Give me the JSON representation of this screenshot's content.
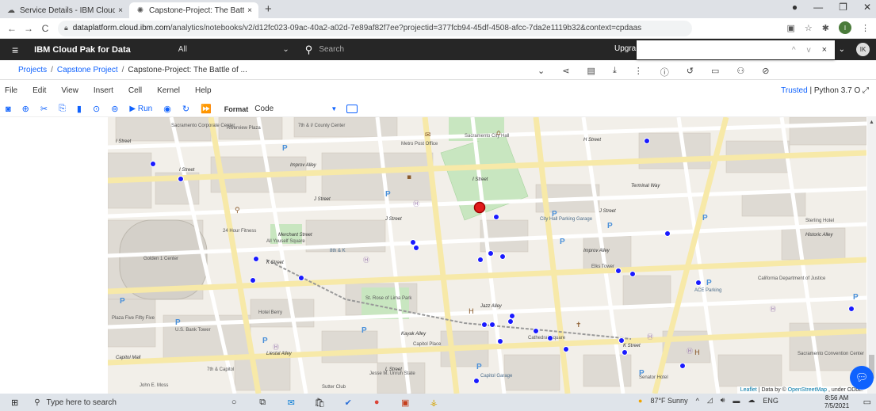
{
  "browser": {
    "tabs": [
      {
        "title": "Service Details - IBM Cloud",
        "active": false,
        "close": "×"
      },
      {
        "title": "Capstone-Project: The Battle of N",
        "active": true,
        "close": "×"
      }
    ],
    "new_tab": "+",
    "window_controls": [
      "●",
      "—",
      "❐",
      "✕"
    ],
    "url_host": "dataplatform.cloud.ibm.com",
    "url_path": "/analytics/notebooks/v2/d12fc023-09ac-40a2-a02d-7e89af82f7ee?projectid=377fcb94-45df-4508-afcc-7da2e1119b32&context=cpdaas",
    "profile_initial": "I"
  },
  "ibm_header": {
    "brand": "IBM Cloud Pak for Data",
    "scope": "All",
    "search_placeholder": "Search",
    "upgrade": "Upgra",
    "avatar": "IK",
    "find_controls": [
      "^",
      "v",
      "×"
    ]
  },
  "breadcrumb": {
    "projects": "Projects",
    "separator": "/",
    "project": "Capstone Project",
    "notebook": "Capstone-Project: The Battle of ..."
  },
  "menu": {
    "items": [
      "File",
      "Edit",
      "View",
      "Insert",
      "Cell",
      "Kernel",
      "Help"
    ],
    "trusted": "Trusted",
    "kernel": "Python 3.7",
    "kernel_status": "O"
  },
  "toolbar": {
    "run_label": "Run",
    "format_label": "Format",
    "cell_type": "Code"
  },
  "map": {
    "streets": [
      "I Street",
      "J Street",
      "K Street",
      "L Street",
      "H Street",
      "Merchant Street",
      "Capitol Mall",
      "Improv Alley",
      "Terminal Way",
      "Kayak Alley",
      "Jazz Alley",
      "Liestal Alley",
      "Historic Alley"
    ],
    "places": [
      "Sacramento Corporate Center",
      "Riverview Plaza",
      "7th & I/ County Center",
      "Metro Post Office",
      "Sacramento City Hall",
      "Golden 1 Center",
      "U.S. Bank Tower",
      "Plaza Five Fifty Five",
      "Hotel Berry",
      "St. Rose of Lima Park",
      "Capitol Place",
      "Cathedral Square",
      "City Hall Parking Garage",
      "California Department of Justice",
      "Sacramento Convention Center",
      "Sterling Hotel",
      "Elks Tower",
      "ACE Parking",
      "Jesse M. Unruh State",
      "Capitol Garage",
      "Senator Hotel",
      "24 Hour Fitness",
      "All Youself Square",
      "8th & K",
      "7th & Capitol",
      "John E. Moss",
      "Sutter Club"
    ],
    "attribution_leaflet": "Leaflet",
    "attribution_text": "| Data by ©",
    "attribution_osm": "OpenStreetMap",
    "attribution_tail": ", under ODbL."
  },
  "taskbar": {
    "search_placeholder": "Type here to search",
    "weather": "87°F Sunny",
    "language": "ENG",
    "time": "8:56 AM",
    "date": "7/5/2021"
  },
  "colors": {
    "ibm_header": "#262626",
    "link": "#0f62fe",
    "marker_blue": "#1a1aff",
    "marker_red": "#e21b1b",
    "park_green": "#c8e6c0",
    "street_yellow": "#f7e9a8"
  }
}
